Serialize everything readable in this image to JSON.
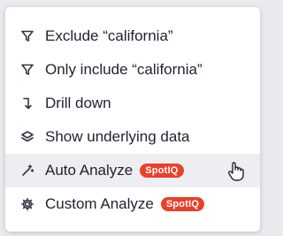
{
  "menu": {
    "items": [
      {
        "label": "Exclude “california”",
        "icon": "filter-icon"
      },
      {
        "label": "Only include “california”",
        "icon": "filter-icon"
      },
      {
        "label": "Drill down",
        "icon": "drill-down-arrow-icon"
      },
      {
        "label": "Show underlying data",
        "icon": "layers-icon"
      },
      {
        "label": "Auto Analyze",
        "icon": "sparkle-wand-icon",
        "badge": "SpotIQ"
      },
      {
        "label": "Custom Analyze",
        "icon": "gear-icon",
        "badge": "SpotIQ"
      }
    ]
  },
  "colors": {
    "badge": "#e8412a",
    "hover_background": "#eceef1",
    "text": "#1d232f"
  }
}
